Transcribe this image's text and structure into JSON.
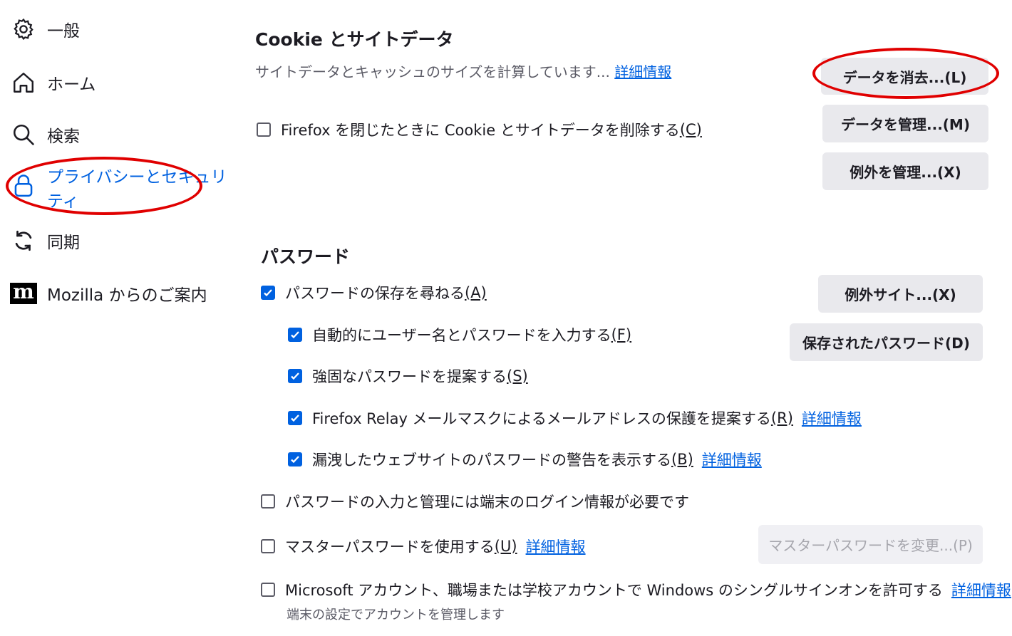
{
  "sidebar": {
    "items": [
      {
        "label": "一般",
        "icon": "gear-icon"
      },
      {
        "label": "ホーム",
        "icon": "home-icon"
      },
      {
        "label": "検索",
        "icon": "search-icon"
      },
      {
        "label": "プライバシーとセキュリティ",
        "label_line1": "プライバシーとセキュリ",
        "label_line2": "ティ",
        "icon": "lock-icon",
        "active": true
      },
      {
        "label": "同期",
        "icon": "sync-icon"
      },
      {
        "label": "Mozilla からのご案内",
        "icon": "mozilla-logo-icon"
      }
    ]
  },
  "cookies": {
    "title": "Cookie とサイトデータ",
    "status": "サイトデータとキャッシュのサイズを計算しています...",
    "learn_more": "詳細情報",
    "delete_on_close_label": "Firefox を閉じたときに Cookie とサイトデータを削除する",
    "delete_on_close_key": "(C)",
    "delete_on_close_checked": false,
    "clear_button": "データを消去...(L)",
    "manage_button": "データを管理...(M)",
    "exceptions_button": "例外を管理...(X)"
  },
  "passwords": {
    "title": "パスワード",
    "ask_save": {
      "label": "パスワードの保存を尋ねる",
      "key": "(A)",
      "checked": true
    },
    "autofill": {
      "label": "自動的にユーザー名とパスワードを入力する",
      "key": "(F)",
      "checked": true
    },
    "suggest_strong": {
      "label": "強固なパスワードを提案する",
      "key": "(S)",
      "checked": true
    },
    "relay": {
      "label": "Firefox Relay メールマスクによるメールアドレスの保護を提案する",
      "key": "(R)",
      "checked": true,
      "link": "詳細情報"
    },
    "breach": {
      "label": "漏洩したウェブサイトのパスワードの警告を表示する",
      "key": "(B)",
      "checked": true,
      "link": "詳細情報"
    },
    "os_auth": {
      "label": "パスワードの入力と管理には端末のログイン情報が必要です",
      "checked": false
    },
    "primary_pw": {
      "label": "マスターパスワードを使用する",
      "key": "(U)",
      "checked": false,
      "link": "詳細情報"
    },
    "sso": {
      "label": "Microsoft アカウント、職場または学校アカウントで Windows のシングルサインオンを許可する",
      "checked": false,
      "link": "詳細情報",
      "sub": "端末の設定でアカウントを管理します"
    },
    "exceptions_button": "例外サイト...(X)",
    "saved_button": "保存されたパスワード(D)",
    "change_primary_button": "マスターパスワードを変更...(P)"
  },
  "colors": {
    "accent": "#0061e0",
    "annotation": "#e00000",
    "button_bg": "#e9e9ed"
  }
}
